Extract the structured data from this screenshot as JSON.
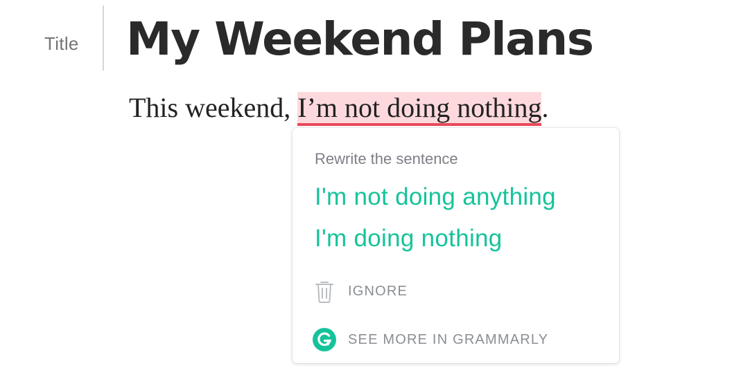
{
  "editor": {
    "title_label": "Title",
    "document_title": "My Weekend Plans",
    "body_before": "This weekend, ",
    "body_flagged": "I’m not doing nothing",
    "body_after": "."
  },
  "suggestion_card": {
    "heading": "Rewrite the sentence",
    "suggestions": [
      "I'm not doing anything",
      "I'm doing nothing"
    ],
    "ignore_label": "IGNORE",
    "see_more_label": "SEE MORE IN GRAMMARLY",
    "icons": {
      "ignore": "trash-icon",
      "see_more": "grammarly-logo-icon"
    }
  },
  "colors": {
    "accent_green": "#15c39a",
    "error_red": "#e8495b",
    "error_highlight": "#fdd9dd"
  }
}
